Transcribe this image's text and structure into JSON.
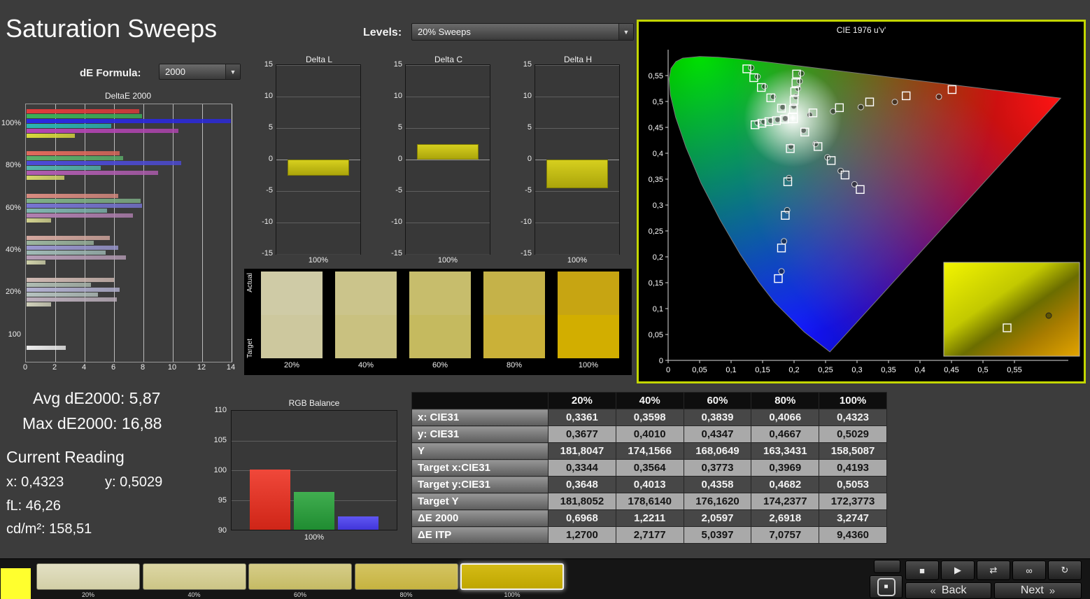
{
  "page": {
    "title": "Saturation Sweeps"
  },
  "controls": {
    "de_formula_label": "dE Formula:",
    "de_formula_value": "2000",
    "levels_label": "Levels:",
    "levels_value": "20% Sweeps"
  },
  "deltae_chart": {
    "title": "DeltaE 2000",
    "x_max": 14,
    "x_ticks": [
      "0",
      "2",
      "4",
      "6",
      "8",
      "10",
      "12",
      "14"
    ],
    "groups": [
      {
        "label": "100%",
        "colors": [
          "#e23b3b",
          "#3cb057",
          "#2a28e2",
          "#2ab3b3",
          "#b344b3",
          "#d9d93c"
        ],
        "values": [
          7.7,
          7.9,
          16.88,
          5.8,
          10.4,
          3.3
        ]
      },
      {
        "label": "80%",
        "colors": [
          "#e06a5c",
          "#5cb06a",
          "#4c4ad8",
          "#55b3ae",
          "#b05cb0",
          "#d5d56a"
        ],
        "values": [
          6.4,
          6.6,
          10.6,
          5.1,
          9.0,
          2.6
        ]
      },
      {
        "label": "60%",
        "colors": [
          "#d98b80",
          "#7fb087",
          "#7674d2",
          "#80b5b0",
          "#b07fb0",
          "#d2d28f"
        ],
        "values": [
          6.3,
          7.8,
          7.9,
          5.5,
          7.3,
          1.7
        ]
      },
      {
        "label": "40%",
        "colors": [
          "#d4a89f",
          "#9cb59f",
          "#9a98d0",
          "#a0bab6",
          "#b59cb5",
          "#d0d2aa"
        ],
        "values": [
          5.7,
          4.6,
          6.3,
          5.4,
          6.8,
          1.3
        ]
      },
      {
        "label": "20%",
        "colors": [
          "#cfb9b2",
          "#afbcb2",
          "#b2b1d0",
          "#b5c2bf",
          "#bcafbc",
          "#d0d0ba"
        ],
        "values": [
          6.0,
          4.4,
          6.4,
          4.9,
          6.2,
          1.7
        ]
      },
      {
        "label": "100",
        "pad": 36,
        "colors": [
          "#ededed"
        ],
        "values": [
          2.7
        ]
      }
    ]
  },
  "delta_axis": {
    "min": -15,
    "max": 15,
    "ticks": [
      15,
      10,
      5,
      0,
      -5,
      -10,
      -15
    ]
  },
  "delta_charts": [
    {
      "title": "Delta L",
      "value": -2.6,
      "x_label": "100%"
    },
    {
      "title": "Delta C",
      "value": 2.4,
      "x_label": "100%"
    },
    {
      "title": "Delta H",
      "value": -4.6,
      "x_label": "100%"
    }
  ],
  "swatches": {
    "row_labels": [
      "Actual",
      "Target"
    ],
    "items": [
      {
        "label": "20%",
        "actual": "#cfcba6",
        "target": "#cdc89e"
      },
      {
        "label": "40%",
        "actual": "#cbc48b",
        "target": "#c9c180"
      },
      {
        "label": "60%",
        "actual": "#c7bd6c",
        "target": "#c5ba5f"
      },
      {
        "label": "80%",
        "actual": "#c5b249",
        "target": "#cab138"
      },
      {
        "label": "100%",
        "actual": "#c7a512",
        "target": "#d2ae00"
      }
    ]
  },
  "cie": {
    "title": "CIE 1976 u'v'",
    "x_ticks": [
      "0",
      "0,05",
      "0,1",
      "0,15",
      "0,2",
      "0,25",
      "0,3",
      "0,35",
      "0,4",
      "0,45",
      "0,5",
      "0,55"
    ],
    "y_ticks": [
      "0",
      "0,05",
      "0,1",
      "0,15",
      "0,2",
      "0,25",
      "0,3",
      "0,35",
      "0,4",
      "0,45",
      "0,5",
      "0,55"
    ],
    "white_point": [
      0.198,
      0.468
    ],
    "targets": [
      [
        0.23,
        0.478
      ],
      [
        0.272,
        0.488
      ],
      [
        0.32,
        0.499
      ],
      [
        0.378,
        0.511
      ],
      [
        0.451,
        0.523
      ],
      [
        0.18,
        0.487
      ],
      [
        0.163,
        0.507
      ],
      [
        0.148,
        0.527
      ],
      [
        0.136,
        0.546
      ],
      [
        0.125,
        0.563
      ],
      [
        0.194,
        0.409
      ],
      [
        0.19,
        0.345
      ],
      [
        0.186,
        0.28
      ],
      [
        0.18,
        0.217
      ],
      [
        0.175,
        0.158
      ],
      [
        0.185,
        0.466
      ],
      [
        0.172,
        0.463
      ],
      [
        0.16,
        0.461
      ],
      [
        0.149,
        0.458
      ],
      [
        0.138,
        0.455
      ],
      [
        0.217,
        0.441
      ],
      [
        0.238,
        0.413
      ],
      [
        0.259,
        0.386
      ],
      [
        0.281,
        0.358
      ],
      [
        0.305,
        0.33
      ],
      [
        0.199,
        0.485
      ],
      [
        0.2,
        0.502
      ],
      [
        0.201,
        0.519
      ],
      [
        0.203,
        0.536
      ],
      [
        0.204,
        0.553
      ]
    ],
    "measurements": [
      [
        0.225,
        0.474
      ],
      [
        0.262,
        0.481
      ],
      [
        0.306,
        0.489
      ],
      [
        0.36,
        0.499
      ],
      [
        0.43,
        0.509
      ],
      [
        0.182,
        0.489
      ],
      [
        0.167,
        0.509
      ],
      [
        0.153,
        0.529
      ],
      [
        0.142,
        0.548
      ],
      [
        0.132,
        0.565
      ],
      [
        0.195,
        0.413
      ],
      [
        0.192,
        0.352
      ],
      [
        0.189,
        0.29
      ],
      [
        0.184,
        0.23
      ],
      [
        0.18,
        0.172
      ],
      [
        0.186,
        0.467
      ],
      [
        0.174,
        0.465
      ],
      [
        0.163,
        0.463
      ],
      [
        0.152,
        0.461
      ],
      [
        0.142,
        0.459
      ],
      [
        0.215,
        0.444
      ],
      [
        0.234,
        0.418
      ],
      [
        0.253,
        0.392
      ],
      [
        0.274,
        0.366
      ],
      [
        0.296,
        0.34
      ],
      [
        0.1995,
        0.491
      ],
      [
        0.2029,
        0.509
      ],
      [
        0.2062,
        0.525
      ],
      [
        0.2089,
        0.539
      ],
      [
        0.2116,
        0.554
      ]
    ]
  },
  "readings": {
    "avg": "Avg dE2000: 5,87",
    "max": "Max dE2000: 16,88",
    "current": "Current Reading",
    "x": "x: 0,4323",
    "y": "y: 0,5029",
    "fl": "fL: 46,26",
    "cd": "cd/m²: 158,51"
  },
  "rgb_balance": {
    "title": "RGB Balance",
    "y_min": 90,
    "y_max": 110,
    "y_ticks": [
      110,
      105,
      100,
      95,
      90
    ],
    "x_label": "100%",
    "bars": [
      {
        "name": "red",
        "color": "#f0483a",
        "color2": "#cf2517",
        "value": 100.1
      },
      {
        "name": "green",
        "color": "#41ae50",
        "color2": "#1f8c31",
        "value": 96.4
      },
      {
        "name": "blue",
        "color": "#6057f2",
        "color2": "#4135da",
        "value": 92.2
      }
    ]
  },
  "table": {
    "columns": [
      "",
      "20%",
      "40%",
      "60%",
      "80%",
      "100%"
    ],
    "rows": [
      {
        "label": "x: CIE31",
        "values": [
          "0,3361",
          "0,3598",
          "0,3839",
          "0,4066",
          "0,4323"
        ]
      },
      {
        "label": "y: CIE31",
        "values": [
          "0,3677",
          "0,4010",
          "0,4347",
          "0,4667",
          "0,5029"
        ]
      },
      {
        "label": "Y",
        "values": [
          "181,8047",
          "174,1566",
          "168,0649",
          "163,3431",
          "158,5087"
        ]
      },
      {
        "label": "Target x:CIE31",
        "values": [
          "0,3344",
          "0,3564",
          "0,3773",
          "0,3969",
          "0,4193"
        ]
      },
      {
        "label": "Target y:CIE31",
        "values": [
          "0,3648",
          "0,4013",
          "0,4358",
          "0,4682",
          "0,5053"
        ]
      },
      {
        "label": "Target Y",
        "values": [
          "181,8052",
          "178,6140",
          "176,1620",
          "174,2377",
          "172,3773"
        ]
      },
      {
        "label": "ΔE 2000",
        "values": [
          "0,6968",
          "1,2211",
          "2,0597",
          "2,6918",
          "3,2747"
        ]
      },
      {
        "label": "ΔE ITP",
        "values": [
          "1,2700",
          "2,7177",
          "5,0397",
          "7,0757",
          "9,4360"
        ]
      }
    ]
  },
  "bottom": {
    "swatch_buttons": [
      {
        "label": "20%",
        "color_top": "#e3e0c4",
        "color": "#d2cfa6",
        "selected": false
      },
      {
        "label": "40%",
        "color_top": "#ddd7a5",
        "color": "#ccc586",
        "selected": false
      },
      {
        "label": "60%",
        "color_top": "#d6cd89",
        "color": "#c5bb64",
        "selected": false
      },
      {
        "label": "80%",
        "color_top": "#d4c462",
        "color": "#c6b340",
        "selected": false
      },
      {
        "label": "100%",
        "color_top": "#d4bb16",
        "color": "#bfa600",
        "selected": true
      }
    ],
    "transport_icons": [
      {
        "name": "stop-icon",
        "glyph": "■"
      },
      {
        "name": "play-icon",
        "glyph": "▶"
      },
      {
        "name": "step-icon",
        "glyph": "⇄"
      },
      {
        "name": "loop-icon",
        "glyph": "∞"
      },
      {
        "name": "refresh-icon",
        "glyph": "↻"
      }
    ],
    "stop_glyph": "■",
    "back_arrow": "«",
    "back_label": "Back",
    "next_label": "Next",
    "next_arrow": "»"
  }
}
